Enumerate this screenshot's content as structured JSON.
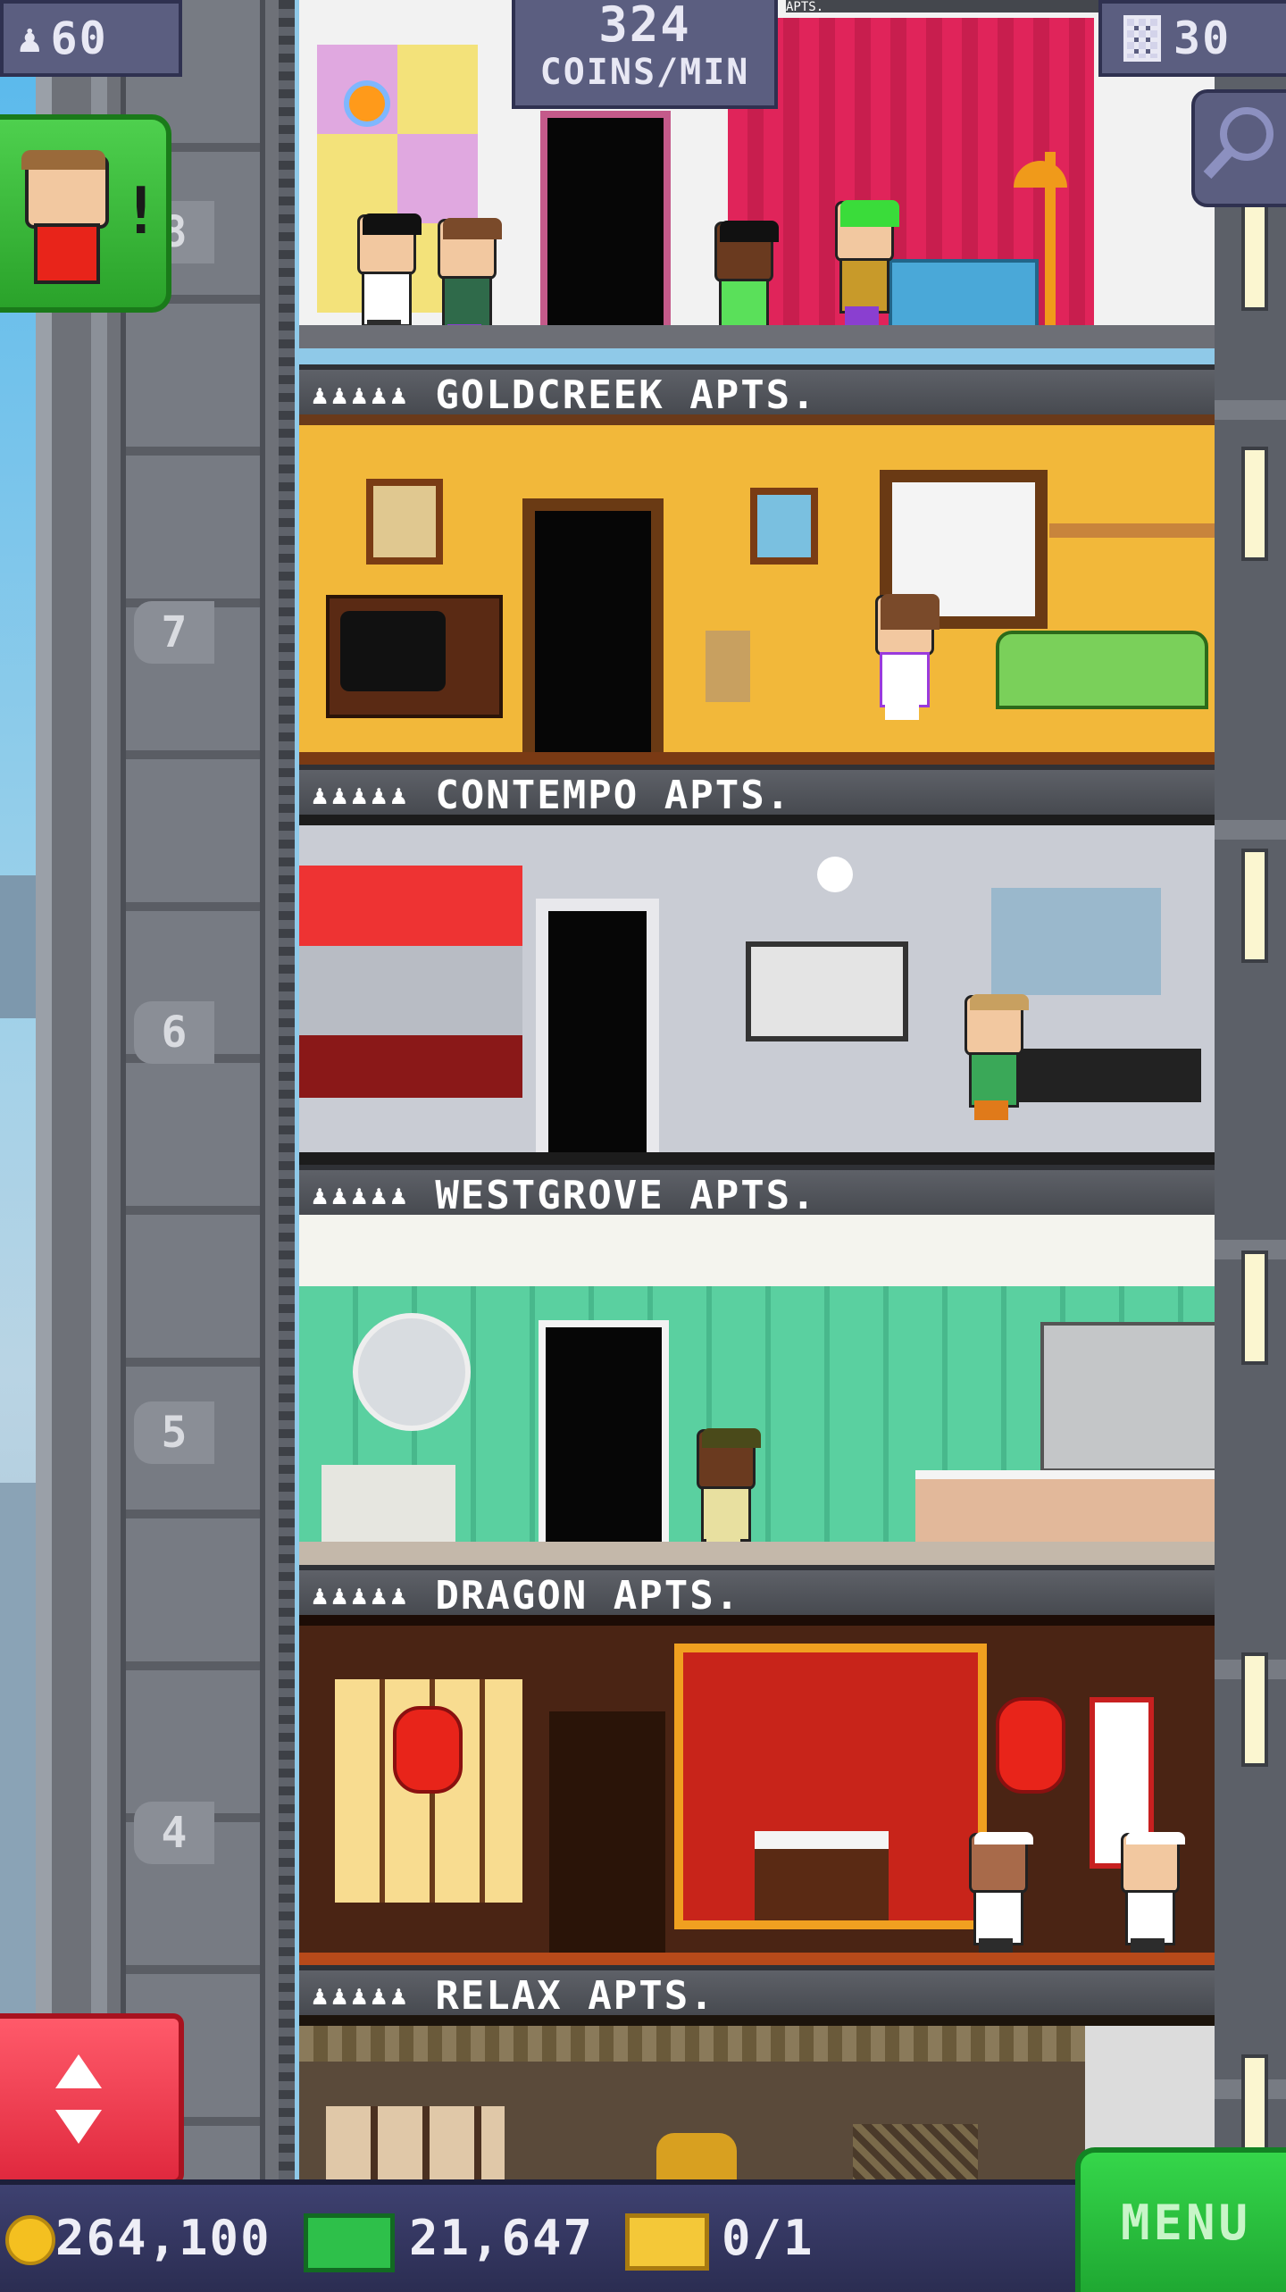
{
  "hud": {
    "population": "60",
    "coins_per_min_value": "324",
    "coins_per_min_unit": "COINS/MIN",
    "floors": "30",
    "top_floor_partial_label": "APTS."
  },
  "elevator": {
    "floor_numbers": [
      "8",
      "7",
      "6",
      "5",
      "4"
    ]
  },
  "floors": [
    {
      "name": "GOLDCREEK APTS.",
      "stars": "♟♟♟♟♟"
    },
    {
      "name": "CONTEMPO APTS.",
      "stars": "♟♟♟♟♟"
    },
    {
      "name": "WESTGROVE APTS.",
      "stars": "♟♟♟♟♟"
    },
    {
      "name": "DRAGON APTS.",
      "stars": "♟♟♟♟♟"
    },
    {
      "name": "RELAX APTS.",
      "stars": "♟♟♟♟♟"
    }
  ],
  "notification": {
    "mark": "!"
  },
  "bottom_bar": {
    "coins": "264,100",
    "bux": "21,647",
    "tickets": "0/1",
    "menu_label": "MENU"
  },
  "colors": {
    "hud_bg": "#5b5e80",
    "menu_green": "#2fc544",
    "elevator_red": "#e8323f",
    "notify_green": "#3cc43c"
  },
  "icons": {
    "population": "person-icon",
    "floors": "building-icon",
    "search": "magnifier-icon",
    "elevator": "up-down-arrows-icon",
    "coins": "coin-icon",
    "bux": "banknote-icon",
    "tickets": "golden-ticket-icon"
  }
}
